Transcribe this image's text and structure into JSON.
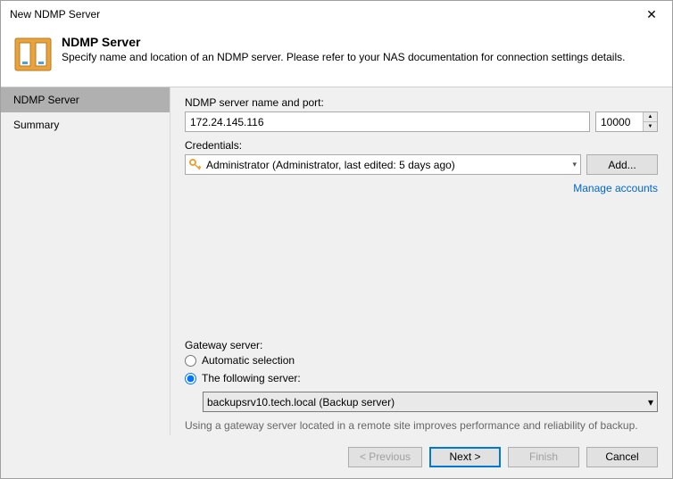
{
  "window": {
    "title": "New NDMP Server"
  },
  "header": {
    "title": "NDMP Server",
    "subtitle": "Specify name and location of an NDMP server. Please refer to your NAS documentation for connection settings details."
  },
  "sidebar": {
    "items": [
      {
        "label": "NDMP Server",
        "active": true
      },
      {
        "label": "Summary",
        "active": false
      }
    ]
  },
  "form": {
    "server_label": "NDMP server name and port:",
    "server_value": "172.24.145.116",
    "port_value": "10000",
    "credentials_label": "Credentials:",
    "credentials_value": "Administrator (Administrator, last edited: 5 days ago)",
    "add_button": "Add...",
    "manage_link": "Manage accounts",
    "gateway_label": "Gateway server:",
    "gateway_auto": "Automatic selection",
    "gateway_following": "The following server:",
    "gateway_value": "backupsrv10.tech.local (Backup server)",
    "gateway_hint": "Using a gateway server located in a remote site improves performance and reliability of backup."
  },
  "footer": {
    "previous": "< Previous",
    "next": "Next >",
    "finish": "Finish",
    "cancel": "Cancel"
  }
}
